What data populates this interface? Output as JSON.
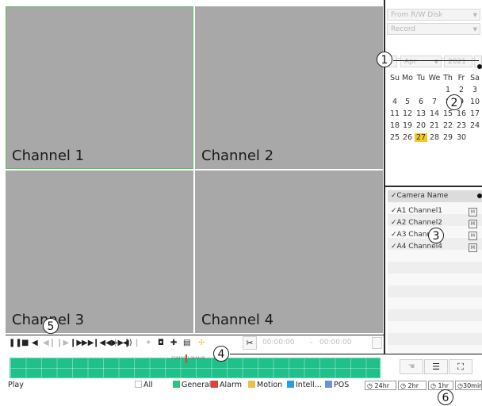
{
  "channels": [
    {
      "label": "Channel 1"
    },
    {
      "label": "Channel 2"
    },
    {
      "label": "Channel 3"
    },
    {
      "label": "Channel 4"
    }
  ],
  "source": {
    "disk": "From R/W Disk",
    "type": "Record"
  },
  "calendar": {
    "month": "Apr",
    "year": "2021",
    "weekdays": [
      "Su",
      "Mo",
      "Tu",
      "We",
      "Th",
      "Fr",
      "Sa"
    ],
    "weeks": [
      [
        "",
        "",
        "",
        "",
        "1",
        "2",
        "3"
      ],
      [
        "4",
        "5",
        "6",
        "7",
        "8",
        "9",
        "10"
      ],
      [
        "11",
        "12",
        "13",
        "14",
        "15",
        "16",
        "17"
      ],
      [
        "18",
        "19",
        "20",
        "21",
        "22",
        "23",
        "24"
      ],
      [
        "25",
        "26",
        "27",
        "28",
        "29",
        "30",
        ""
      ]
    ],
    "selected": "27"
  },
  "camera_list": {
    "header": "Camera Name",
    "items": [
      {
        "name": "A1 Channel1",
        "badge": "M"
      },
      {
        "name": "A2 Channel2",
        "badge": "M"
      },
      {
        "name": "A3 Channel3",
        "badge": "M"
      },
      {
        "name": "A4 Channel4",
        "badge": "M"
      }
    ]
  },
  "clip": {
    "start": "00:00:00",
    "sep": "-",
    "end": "00:00:00"
  },
  "legend": {
    "all": "All",
    "items": [
      {
        "label": "General",
        "color": "#2ec27e"
      },
      {
        "label": "Alarm",
        "color": "#e0413b"
      },
      {
        "label": "Motion",
        "color": "#e8c24a"
      },
      {
        "label": "Intell...",
        "color": "#2a9de0"
      },
      {
        "label": "POS",
        "color": "#6f8fe0"
      }
    ]
  },
  "status": "Play",
  "time_scales": [
    "24hr",
    "2hr",
    "1hr",
    "30min"
  ],
  "timeline_marker": "27/04/2021 00:04:00",
  "callouts": [
    "1",
    "2",
    "3",
    "4",
    "5",
    "6"
  ],
  "colors": {
    "timeline": "#1fc08a",
    "selected_day": "#f3c82b",
    "selected_channel": "#5fbf5f"
  }
}
